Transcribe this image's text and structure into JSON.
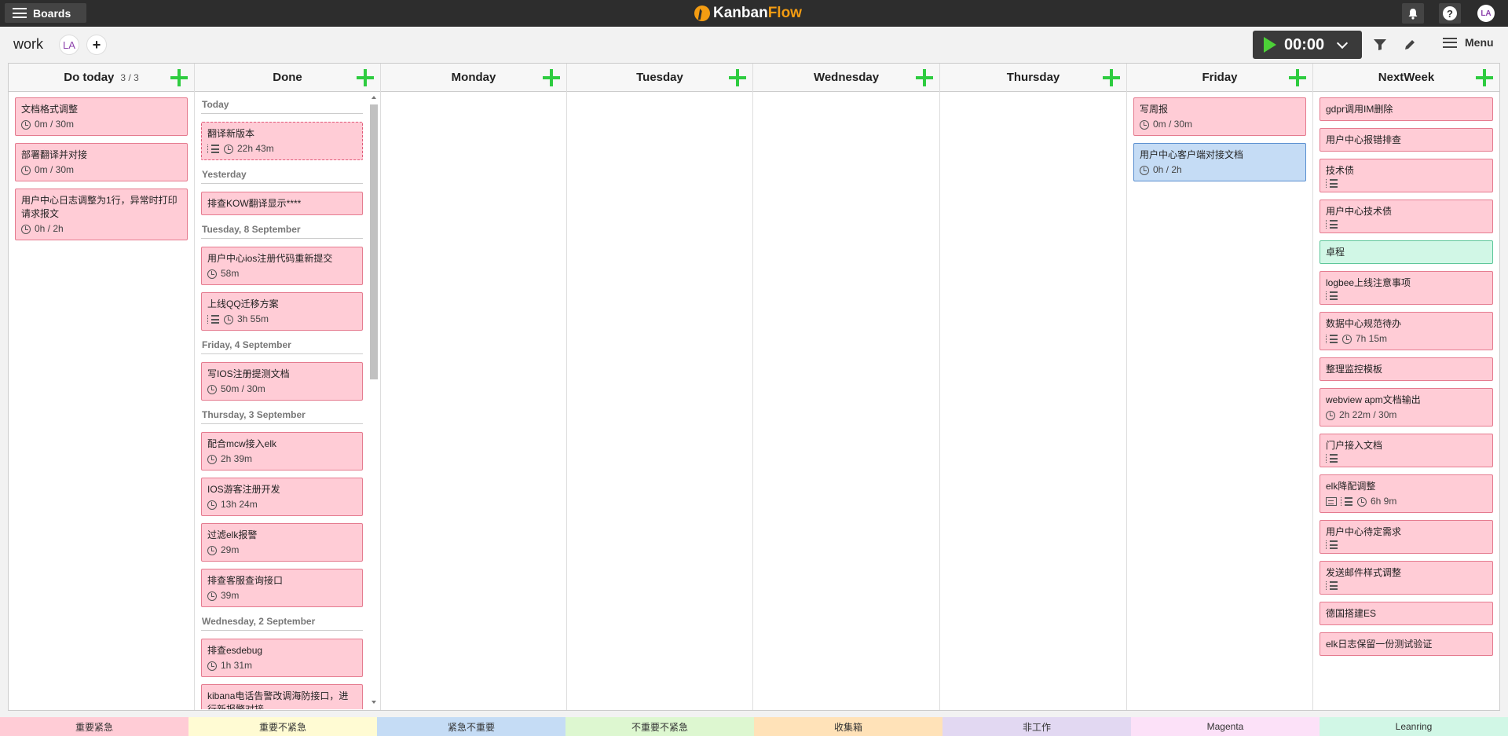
{
  "app": {
    "logo_left": "Kanban",
    "logo_right": "Flow",
    "boards_label": "Boards",
    "user_initials": "LA",
    "help_label": "?"
  },
  "board": {
    "name": "work",
    "member_initials": "LA",
    "add_label": "+",
    "timer": "00:00",
    "menu_label": "Menu"
  },
  "columns": {
    "do_today": {
      "title": "Do today",
      "count": "3 / 3",
      "cards": [
        {
          "title": "文档格式调整",
          "time": "0m / 30m"
        },
        {
          "title": "部署翻译并对接",
          "time": "0m / 30m"
        },
        {
          "title": "用户中心日志调整为1行，异常时打印请求报文",
          "time": "0h / 2h"
        }
      ]
    },
    "done": {
      "title": "Done",
      "groups": [
        {
          "label": "Today",
          "cards": [
            {
              "title": "翻译新版本",
              "time": "22h 43m"
            }
          ]
        },
        {
          "label": "Yesterday",
          "cards": [
            {
              "title": "排查KOW翻译显示****"
            }
          ]
        },
        {
          "label": "Tuesday, 8 September",
          "cards": [
            {
              "title": "用户中心ios注册代码重新提交",
              "time": "58m"
            },
            {
              "title": "上线QQ迁移方案",
              "time": "3h 55m"
            }
          ]
        },
        {
          "label": "Friday, 4 September",
          "cards": [
            {
              "title": "写IOS注册提测文档",
              "time": "50m / 30m"
            }
          ]
        },
        {
          "label": "Thursday, 3 September",
          "cards": [
            {
              "title": "配合mcw接入elk",
              "time": "2h 39m"
            },
            {
              "title": "IOS游客注册开发",
              "time": "13h 24m"
            },
            {
              "title": "过滤elk报警",
              "time": "29m"
            },
            {
              "title": "排查客服查询接口",
              "time": "39m"
            }
          ]
        },
        {
          "label": "Wednesday, 2 September",
          "cards": [
            {
              "title": "排查esdebug",
              "time": "1h 31m"
            },
            {
              "title": "kibana电话告警改调海防接口，进行新报警对接"
            }
          ]
        }
      ]
    },
    "monday": {
      "title": "Monday"
    },
    "tuesday": {
      "title": "Tuesday"
    },
    "wednesday": {
      "title": "Wednesday"
    },
    "thursday": {
      "title": "Thursday"
    },
    "friday": {
      "title": "Friday",
      "cards": [
        {
          "title": "写周报",
          "time": "0m / 30m"
        },
        {
          "title": "用户中心客户端对接文档",
          "time": "0h / 2h"
        }
      ]
    },
    "nextweek": {
      "title": "NextWeek",
      "cards": [
        {
          "title": "gdpr调用IM删除"
        },
        {
          "title": "用户中心报错排查"
        },
        {
          "title": "技术债"
        },
        {
          "title": "用户中心技术债"
        },
        {
          "title": "卓程"
        },
        {
          "title": "logbee上线注意事项"
        },
        {
          "title": "数据中心规范待办",
          "time": "7h 15m"
        },
        {
          "title": "整理监控模板"
        },
        {
          "title": "webview apm文档输出",
          "time": "2h 22m / 30m"
        },
        {
          "title": "门户接入文档"
        },
        {
          "title": "elk降配调整",
          "time": "6h 9m"
        },
        {
          "title": "用户中心待定需求"
        },
        {
          "title": "发送邮件样式调整"
        },
        {
          "title": "德国搭建ES"
        },
        {
          "title": "elk日志保留一份测试验证"
        }
      ]
    }
  },
  "legend": [
    {
      "label": "重要紧急",
      "color": "#ffccd6"
    },
    {
      "label": "重要不紧急",
      "color": "#fffbd3"
    },
    {
      "label": "紧急不重要",
      "color": "#c5dcf5"
    },
    {
      "label": "不重要不紧急",
      "color": "#ddf7d0"
    },
    {
      "label": "收集箱",
      "color": "#ffe2b8"
    },
    {
      "label": "非工作",
      "color": "#e2d8f2"
    },
    {
      "label": "Magenta",
      "color": "#fce1f8"
    },
    {
      "label": "Leanring",
      "color": "#d1f7e6"
    }
  ]
}
